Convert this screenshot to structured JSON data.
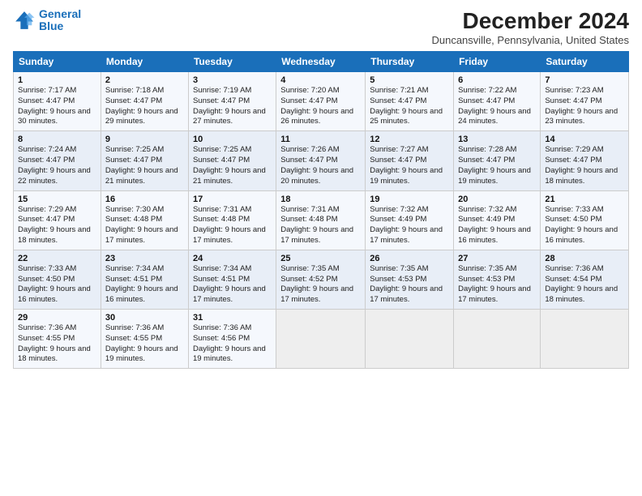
{
  "header": {
    "logo_line1": "General",
    "logo_line2": "Blue",
    "title": "December 2024",
    "subtitle": "Duncansville, Pennsylvania, United States"
  },
  "days_of_week": [
    "Sunday",
    "Monday",
    "Tuesday",
    "Wednesday",
    "Thursday",
    "Friday",
    "Saturday"
  ],
  "weeks": [
    [
      {
        "day": 1,
        "rise": "7:17 AM",
        "set": "4:47 PM",
        "daylight": "9 hours and 30 minutes"
      },
      {
        "day": 2,
        "rise": "7:18 AM",
        "set": "4:47 PM",
        "daylight": "9 hours and 29 minutes"
      },
      {
        "day": 3,
        "rise": "7:19 AM",
        "set": "4:47 PM",
        "daylight": "9 hours and 27 minutes"
      },
      {
        "day": 4,
        "rise": "7:20 AM",
        "set": "4:47 PM",
        "daylight": "9 hours and 26 minutes"
      },
      {
        "day": 5,
        "rise": "7:21 AM",
        "set": "4:47 PM",
        "daylight": "9 hours and 25 minutes"
      },
      {
        "day": 6,
        "rise": "7:22 AM",
        "set": "4:47 PM",
        "daylight": "9 hours and 24 minutes"
      },
      {
        "day": 7,
        "rise": "7:23 AM",
        "set": "4:47 PM",
        "daylight": "9 hours and 23 minutes"
      }
    ],
    [
      {
        "day": 8,
        "rise": "7:24 AM",
        "set": "4:47 PM",
        "daylight": "9 hours and 22 minutes"
      },
      {
        "day": 9,
        "rise": "7:25 AM",
        "set": "4:47 PM",
        "daylight": "9 hours and 21 minutes"
      },
      {
        "day": 10,
        "rise": "7:25 AM",
        "set": "4:47 PM",
        "daylight": "9 hours and 21 minutes"
      },
      {
        "day": 11,
        "rise": "7:26 AM",
        "set": "4:47 PM",
        "daylight": "9 hours and 20 minutes"
      },
      {
        "day": 12,
        "rise": "7:27 AM",
        "set": "4:47 PM",
        "daylight": "9 hours and 19 minutes"
      },
      {
        "day": 13,
        "rise": "7:28 AM",
        "set": "4:47 PM",
        "daylight": "9 hours and 19 minutes"
      },
      {
        "day": 14,
        "rise": "7:29 AM",
        "set": "4:47 PM",
        "daylight": "9 hours and 18 minutes"
      }
    ],
    [
      {
        "day": 15,
        "rise": "7:29 AM",
        "set": "4:47 PM",
        "daylight": "9 hours and 18 minutes"
      },
      {
        "day": 16,
        "rise": "7:30 AM",
        "set": "4:48 PM",
        "daylight": "9 hours and 17 minutes"
      },
      {
        "day": 17,
        "rise": "7:31 AM",
        "set": "4:48 PM",
        "daylight": "9 hours and 17 minutes"
      },
      {
        "day": 18,
        "rise": "7:31 AM",
        "set": "4:48 PM",
        "daylight": "9 hours and 17 minutes"
      },
      {
        "day": 19,
        "rise": "7:32 AM",
        "set": "4:49 PM",
        "daylight": "9 hours and 17 minutes"
      },
      {
        "day": 20,
        "rise": "7:32 AM",
        "set": "4:49 PM",
        "daylight": "9 hours and 16 minutes"
      },
      {
        "day": 21,
        "rise": "7:33 AM",
        "set": "4:50 PM",
        "daylight": "9 hours and 16 minutes"
      }
    ],
    [
      {
        "day": 22,
        "rise": "7:33 AM",
        "set": "4:50 PM",
        "daylight": "9 hours and 16 minutes"
      },
      {
        "day": 23,
        "rise": "7:34 AM",
        "set": "4:51 PM",
        "daylight": "9 hours and 16 minutes"
      },
      {
        "day": 24,
        "rise": "7:34 AM",
        "set": "4:51 PM",
        "daylight": "9 hours and 17 minutes"
      },
      {
        "day": 25,
        "rise": "7:35 AM",
        "set": "4:52 PM",
        "daylight": "9 hours and 17 minutes"
      },
      {
        "day": 26,
        "rise": "7:35 AM",
        "set": "4:53 PM",
        "daylight": "9 hours and 17 minutes"
      },
      {
        "day": 27,
        "rise": "7:35 AM",
        "set": "4:53 PM",
        "daylight": "9 hours and 17 minutes"
      },
      {
        "day": 28,
        "rise": "7:36 AM",
        "set": "4:54 PM",
        "daylight": "9 hours and 18 minutes"
      }
    ],
    [
      {
        "day": 29,
        "rise": "7:36 AM",
        "set": "4:55 PM",
        "daylight": "9 hours and 18 minutes"
      },
      {
        "day": 30,
        "rise": "7:36 AM",
        "set": "4:55 PM",
        "daylight": "9 hours and 19 minutes"
      },
      {
        "day": 31,
        "rise": "7:36 AM",
        "set": "4:56 PM",
        "daylight": "9 hours and 19 minutes"
      },
      null,
      null,
      null,
      null
    ]
  ]
}
